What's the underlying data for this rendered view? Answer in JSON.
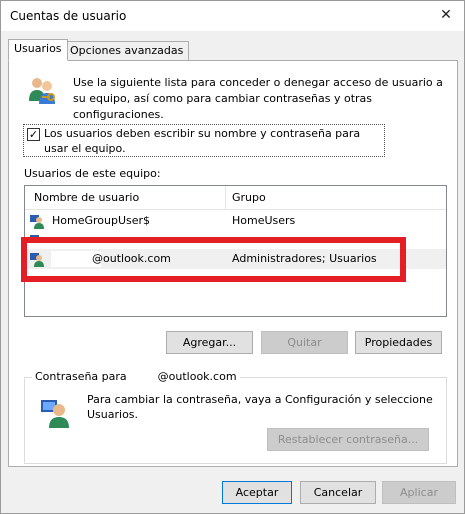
{
  "window": {
    "title": "Cuentas de usuario",
    "close_symbol": "✕"
  },
  "tabs": [
    {
      "label": "Usuarios",
      "active": true
    },
    {
      "label": "Opciones avanzadas",
      "active": false
    }
  ],
  "intro": {
    "text": "Use la siguiente lista para conceder o denegar acceso de usuario a su equipo, así como para cambiar contraseñas y otras configuraciones."
  },
  "require_login": {
    "checked": true,
    "check_mark": "✓",
    "label": "Los usuarios deben escribir su nombre y contraseña para usar el equipo."
  },
  "users_section": {
    "label": "Usuarios de este equipo:",
    "columns": {
      "name": "Nombre de usuario",
      "group": "Grupo"
    },
    "rows": [
      {
        "name": "HomeGroupUser$",
        "group": "HomeUsers"
      },
      {
        "name": "@outlook.com",
        "group": "Administradores; Usuarios"
      }
    ]
  },
  "list_buttons": {
    "add": "Agregar...",
    "remove": "Quitar",
    "properties": "Propiedades"
  },
  "password_section": {
    "legend_prefix": "Contraseña para",
    "legend_account": "@outlook.com",
    "text": "Para cambiar la contraseña, vaya a Configuración y seleccione Usuarios.",
    "reset_button": "Restablecer contraseña..."
  },
  "footer_buttons": {
    "ok": "Aceptar",
    "cancel": "Cancelar",
    "apply": "Aplicar"
  },
  "colors": {
    "highlight": "#e31e24",
    "accent": "#0078d7"
  }
}
